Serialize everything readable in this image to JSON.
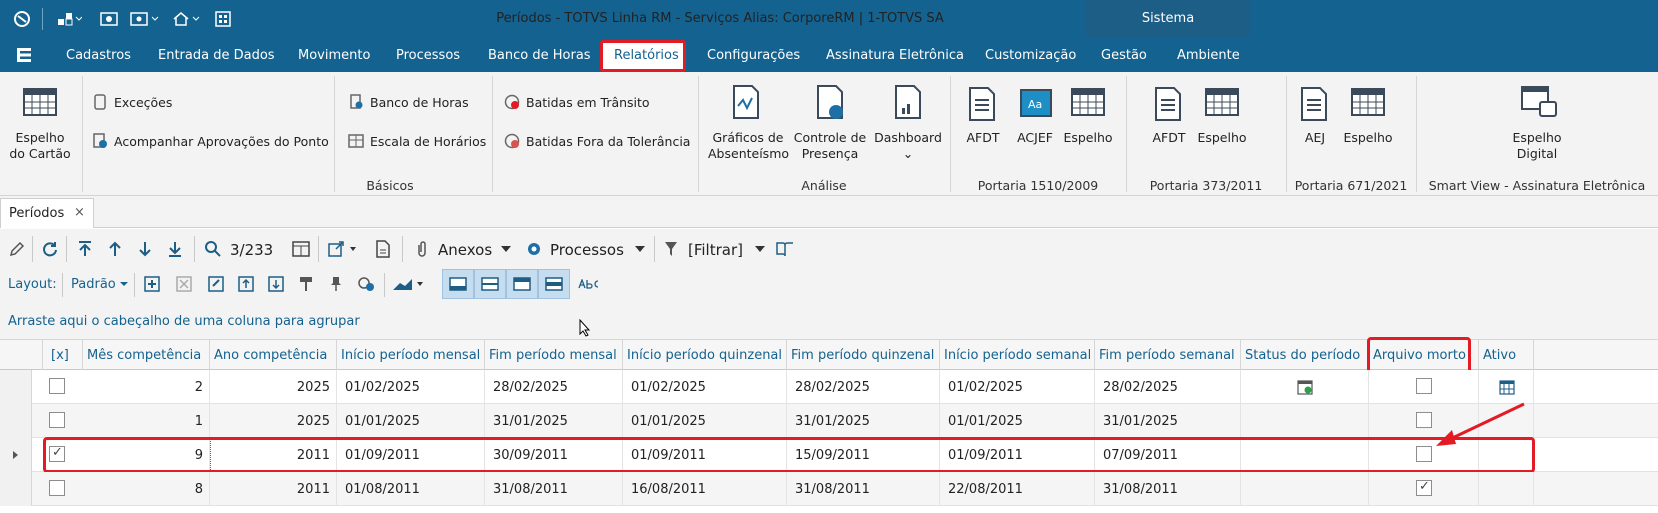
{
  "window": {
    "title": "Períodos - TOTVS Linha RM - Serviços  Alias: CorporeRM | 1-TOTVS SA",
    "sistema": "Sistema"
  },
  "menu": {
    "items": [
      "Cadastros",
      "Entrada de Dados",
      "Movimento",
      "Processos",
      "Banco de Horas",
      "Relatórios",
      "Configurações",
      "Assinatura Eletrônica",
      "Customização",
      "Gestão",
      "Ambiente"
    ],
    "active": "Relatórios"
  },
  "ribbon": {
    "espelho_cartao": [
      "Espelho",
      "do Cartão"
    ],
    "excecoes": "Exceções",
    "acompanhar": "Acompanhar Aprovações do Ponto",
    "banco_horas": "Banco de Horas",
    "escala": "Escala de Horários",
    "batidas_transito": "Batidas em Trânsito",
    "batidas_fora": "Batidas Fora da Tolerância",
    "graficos": [
      "Gráficos de",
      "Absenteísmo"
    ],
    "controle": [
      "Controle de",
      "Presença"
    ],
    "dashboard": "Dashboard",
    "afdt": "AFDT",
    "acjef": "ACJEF",
    "espelho": "Espelho",
    "aej": "AEJ",
    "espelho_digital": [
      "Espelho",
      "Digital"
    ],
    "groups": {
      "basicos": "Básicos",
      "analise": "Análise",
      "p1510": "Portaria 1510/2009",
      "p373": "Portaria 373/2011",
      "p671": "Portaria 671/2021",
      "smartview": "Smart View - Assinatura Eletrônica"
    }
  },
  "doc_tab": {
    "label": "Períodos",
    "close": "×"
  },
  "toolbar": {
    "record_pos": "3/233",
    "anexos": "Anexos",
    "processos": "Processos",
    "filtrar": "[Filtrar]",
    "layout_label": "Layout:",
    "layout_value": "Padrão",
    "group_hint": "Arraste aqui o cabeçalho de uma coluna para agrupar"
  },
  "grid": {
    "columns": [
      "[x]",
      "Mês competência",
      "Ano competência",
      "Início período mensal",
      "Fim período mensal",
      "Início período quinzenal",
      "Fim período quinzenal",
      "Início período semanal",
      "Fim período semanal",
      "Status do período",
      "Arquivo morto",
      "Ativo"
    ],
    "rows": [
      {
        "sel": false,
        "mes": "2",
        "ano": "2025",
        "ini_m": "01/02/2025",
        "fim_m": "28/02/2025",
        "ini_q": "01/02/2025",
        "fim_q": "28/02/2025",
        "ini_s": "01/02/2025",
        "fim_s": "28/02/2025",
        "status_icon": "calendar-status-icon",
        "arquivo": false,
        "ativo_icon": "calendar-icon"
      },
      {
        "sel": false,
        "mes": "1",
        "ano": "2025",
        "ini_m": "01/01/2025",
        "fim_m": "31/01/2025",
        "ini_q": "01/01/2025",
        "fim_q": "31/01/2025",
        "ini_s": "01/01/2025",
        "fim_s": "31/01/2025",
        "arquivo": false
      },
      {
        "sel": true,
        "mes": "9",
        "ano": "2011",
        "ini_m": "01/09/2011",
        "fim_m": "30/09/2011",
        "ini_q": "01/09/2011",
        "fim_q": "15/09/2011",
        "ini_s": "01/09/2011",
        "fim_s": "07/09/2011",
        "arquivo": false,
        "current": true
      },
      {
        "sel": false,
        "mes": "8",
        "ano": "2011",
        "ini_m": "01/08/2011",
        "fim_m": "31/08/2011",
        "ini_q": "16/08/2011",
        "fim_q": "31/08/2011",
        "ini_s": "22/08/2011",
        "fim_s": "31/08/2011",
        "arquivo": true
      }
    ]
  },
  "colors": {
    "brand": "#14628f",
    "highlight": "#e31b24",
    "ribbon_bg": "#f3f3f3"
  }
}
